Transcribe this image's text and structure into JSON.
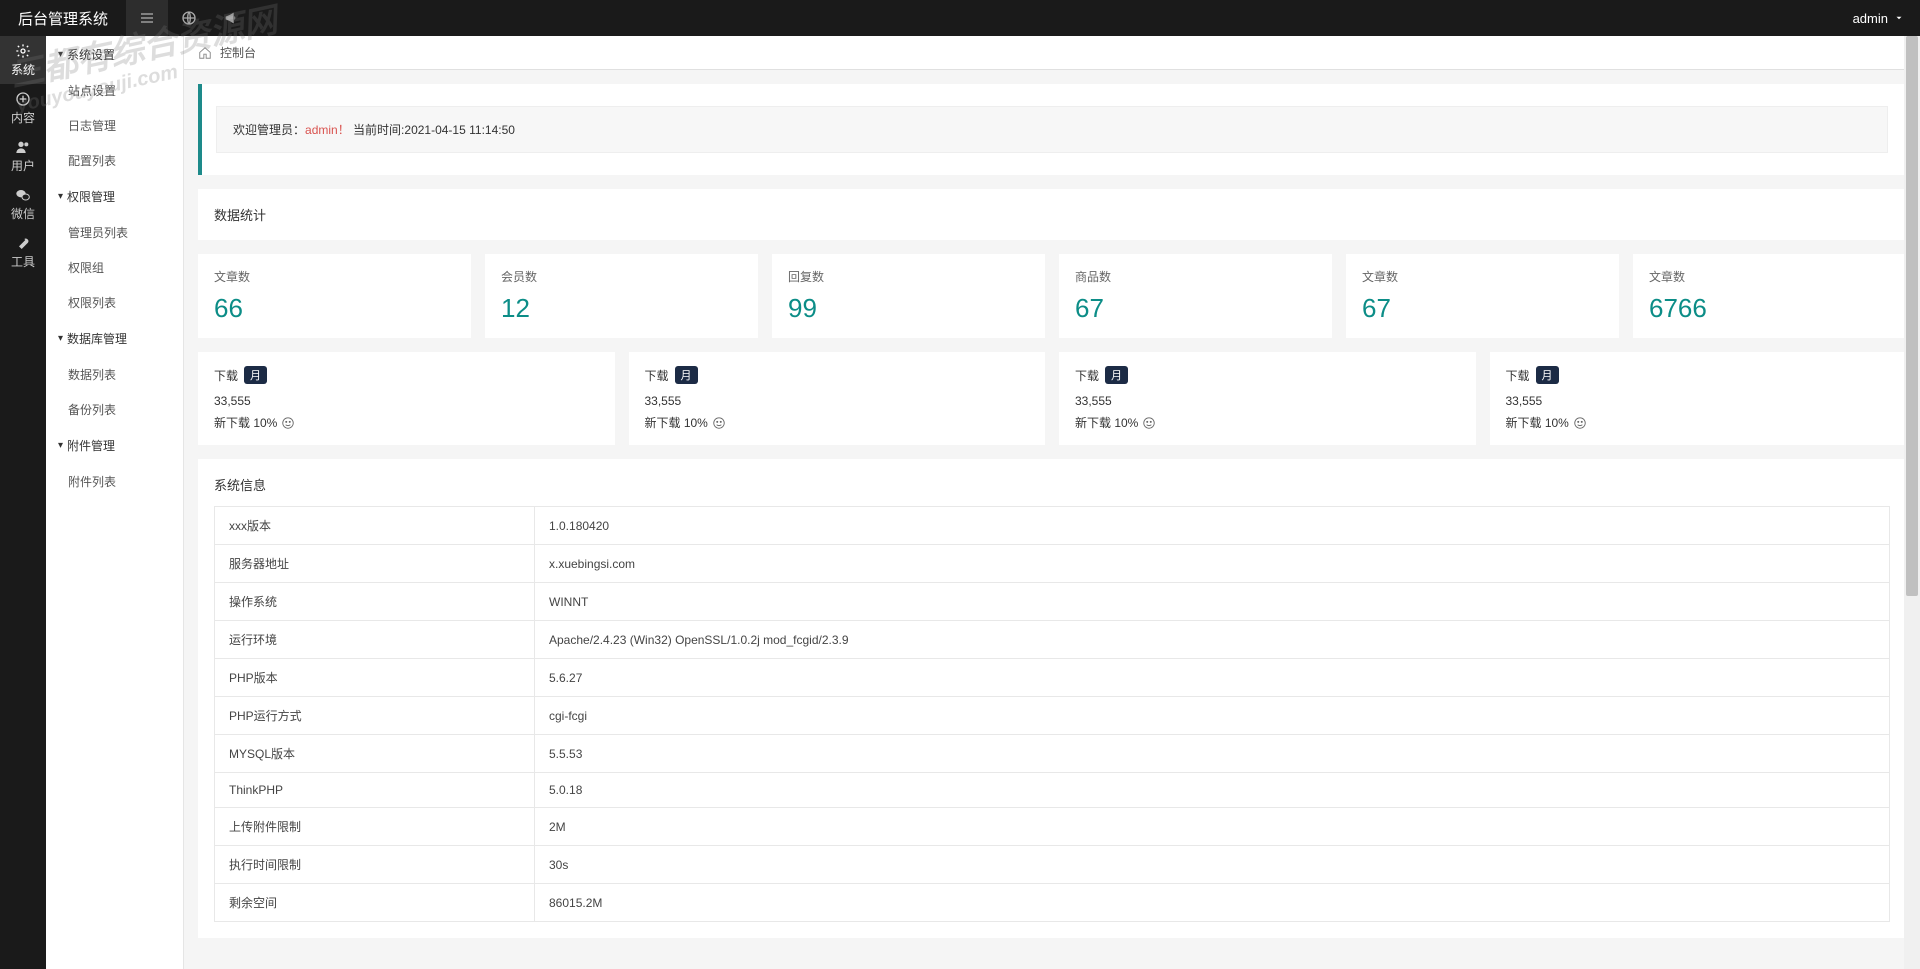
{
  "header": {
    "title": "后台管理系统",
    "user": "admin"
  },
  "navStrip": [
    {
      "label": "系统",
      "icon": "gear"
    },
    {
      "label": "内容",
      "icon": "plus"
    },
    {
      "label": "用户",
      "icon": "users"
    },
    {
      "label": "微信",
      "icon": "wechat"
    },
    {
      "label": "工具",
      "icon": "wrench"
    }
  ],
  "sidebar": {
    "groups": [
      {
        "title": "系统设置",
        "items": [
          "站点设置",
          "日志管理",
          "配置列表"
        ]
      },
      {
        "title": "权限管理",
        "items": [
          "管理员列表",
          "权限组",
          "权限列表"
        ]
      },
      {
        "title": "数据库管理",
        "items": [
          "数据列表",
          "备份列表"
        ]
      },
      {
        "title": "附件管理",
        "items": [
          "附件列表"
        ]
      }
    ]
  },
  "breadcrumb": "控制台",
  "welcome": {
    "prefix": "欢迎管理员：",
    "admin": "admin！",
    "timeLabel": "当前时间:",
    "time": "2021-04-15 11:14:50"
  },
  "statsTitle": "数据统计",
  "stats": [
    {
      "label": "文章数",
      "value": "66"
    },
    {
      "label": "会员数",
      "value": "12"
    },
    {
      "label": "回复数",
      "value": "99"
    },
    {
      "label": "商品数",
      "value": "67"
    },
    {
      "label": "文章数",
      "value": "67"
    },
    {
      "label": "文章数",
      "value": "6766"
    }
  ],
  "downloads": [
    {
      "title": "下载",
      "badge": "月",
      "count": "33,555",
      "new": "新下载 10%"
    },
    {
      "title": "下载",
      "badge": "月",
      "count": "33,555",
      "new": "新下载 10%"
    },
    {
      "title": "下载",
      "badge": "月",
      "count": "33,555",
      "new": "新下载 10%"
    },
    {
      "title": "下载",
      "badge": "月",
      "count": "33,555",
      "new": "新下载 10%"
    }
  ],
  "sysInfoTitle": "系统信息",
  "sysInfo": [
    {
      "k": "xxx版本",
      "v": "1.0.180420"
    },
    {
      "k": "服务器地址",
      "v": "x.xuebingsi.com"
    },
    {
      "k": "操作系统",
      "v": "WINNT"
    },
    {
      "k": "运行环境",
      "v": "Apache/2.4.23 (Win32) OpenSSL/1.0.2j mod_fcgid/2.3.9"
    },
    {
      "k": "PHP版本",
      "v": "5.6.27"
    },
    {
      "k": "PHP运行方式",
      "v": "cgi-fcgi"
    },
    {
      "k": "MYSQL版本",
      "v": "5.5.53"
    },
    {
      "k": "ThinkPHP",
      "v": "5.0.18"
    },
    {
      "k": "上传附件限制",
      "v": "2M"
    },
    {
      "k": "执行时间限制",
      "v": "30s"
    },
    {
      "k": "剩余空间",
      "v": "86015.2M"
    }
  ],
  "watermark": {
    "line1": "三都有综合资源网",
    "line2": "youyouyouji.com"
  }
}
